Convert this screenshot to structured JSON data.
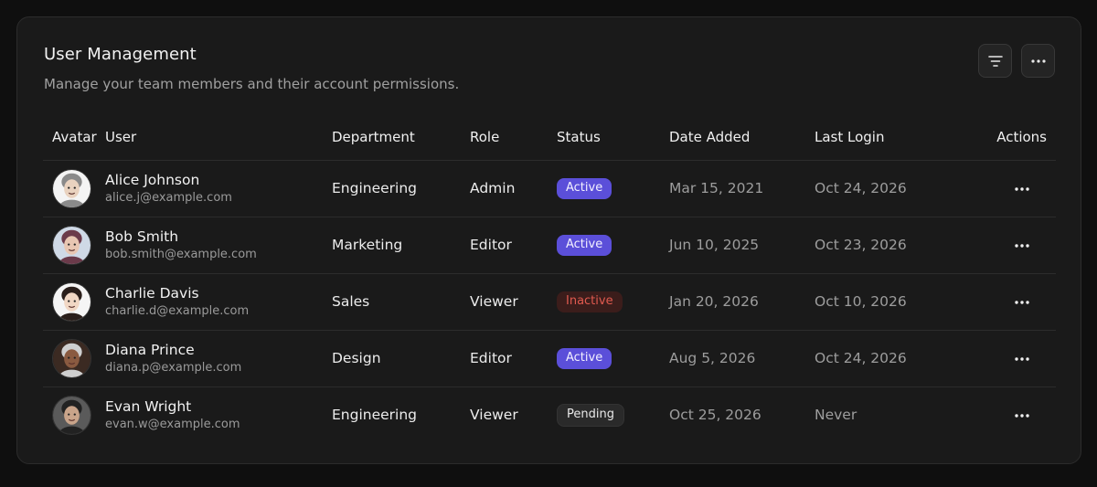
{
  "header": {
    "title": "User Management",
    "subtitle": "Manage your team members and their account permissions."
  },
  "toolbar": {
    "filter_icon": "filter-icon",
    "more_icon": "more-horizontal-icon"
  },
  "table": {
    "columns": [
      "Avatar",
      "User",
      "Department",
      "Role",
      "Status",
      "Date Added",
      "Last Login",
      "Actions"
    ],
    "rows": [
      {
        "name": "Alice Johnson",
        "email": "alice.j@example.com",
        "department": "Engineering",
        "role": "Admin",
        "status": "Active",
        "status_kind": "active",
        "date_added": "Mar 15, 2021",
        "last_login": "Oct 24, 2026",
        "avatar_skin": "#e9d2bf",
        "avatar_bg": "#f4f4f4",
        "avatar_hair": "#8a8a8a"
      },
      {
        "name": "Bob Smith",
        "email": "bob.smith@example.com",
        "department": "Marketing",
        "role": "Editor",
        "status": "Active",
        "status_kind": "active",
        "date_added": "Jun 10, 2025",
        "last_login": "Oct 23, 2026",
        "avatar_skin": "#e8c6b2",
        "avatar_bg": "#cfd9e6",
        "avatar_hair": "#6b3a4a"
      },
      {
        "name": "Charlie Davis",
        "email": "charlie.d@example.com",
        "department": "Sales",
        "role": "Viewer",
        "status": "Inactive",
        "status_kind": "inactive",
        "date_added": "Jan 20, 2026",
        "last_login": "Oct 10, 2026",
        "avatar_skin": "#f1d7c4",
        "avatar_bg": "#f5f5f5",
        "avatar_hair": "#2a1e1a"
      },
      {
        "name": "Diana Prince",
        "email": "diana.p@example.com",
        "department": "Design",
        "role": "Editor",
        "status": "Active",
        "status_kind": "active",
        "date_added": "Aug 5, 2026",
        "last_login": "Oct 24, 2026",
        "avatar_skin": "#8a5a40",
        "avatar_bg": "#3b2a22",
        "avatar_hair": "#cfcfcf"
      },
      {
        "name": "Evan Wright",
        "email": "evan.w@example.com",
        "department": "Engineering",
        "role": "Viewer",
        "status": "Pending",
        "status_kind": "pending",
        "date_added": "Oct 25, 2026",
        "last_login": "Never",
        "avatar_skin": "#c9a48a",
        "avatar_bg": "#5a5a5a",
        "avatar_hair": "#222222"
      }
    ],
    "row_action_icon": "more-horizontal-icon"
  },
  "colors": {
    "accent": "#5b4fd9",
    "inactive": "#e05a4f",
    "background": "#0f0f0f",
    "card": "#1a1a1a"
  }
}
